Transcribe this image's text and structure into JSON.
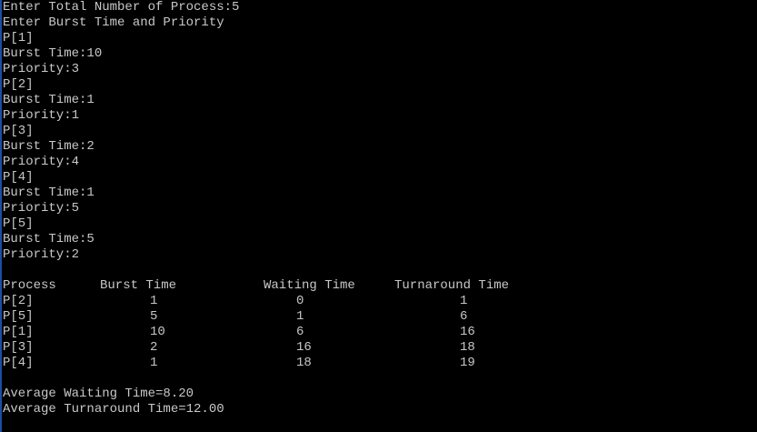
{
  "input_section": {
    "lines": [
      "Enter Total Number of Process:5",
      "Enter Burst Time and Priority",
      "P[1]",
      "Burst Time:10",
      "Priority:3",
      "P[2]",
      "Burst Time:1",
      "Priority:1",
      "P[3]",
      "Burst Time:2",
      "Priority:4",
      "P[4]",
      "Burst Time:1",
      "Priority:5",
      "P[5]",
      "Burst Time:5",
      "Priority:2"
    ]
  },
  "results_table": {
    "headers": [
      "Process",
      "Burst Time",
      "Waiting Time",
      "Turnaround Time"
    ],
    "rows": [
      {
        "process": "P[2]",
        "burst": "1",
        "waiting": "0",
        "turnaround": "1"
      },
      {
        "process": "P[5]",
        "burst": "5",
        "waiting": "1",
        "turnaround": "6"
      },
      {
        "process": "P[1]",
        "burst": "10",
        "waiting": "6",
        "turnaround": "16"
      },
      {
        "process": "P[3]",
        "burst": "2",
        "waiting": "16",
        "turnaround": "18"
      },
      {
        "process": "P[4]",
        "burst": "1",
        "waiting": "18",
        "turnaround": "19"
      }
    ]
  },
  "summary": {
    "avg_waiting": "Average Waiting Time=8.20",
    "avg_turnaround": "Average Turnaround Time=12.00"
  },
  "colors": {
    "background": "#000000",
    "text": "#c8c8c8"
  }
}
